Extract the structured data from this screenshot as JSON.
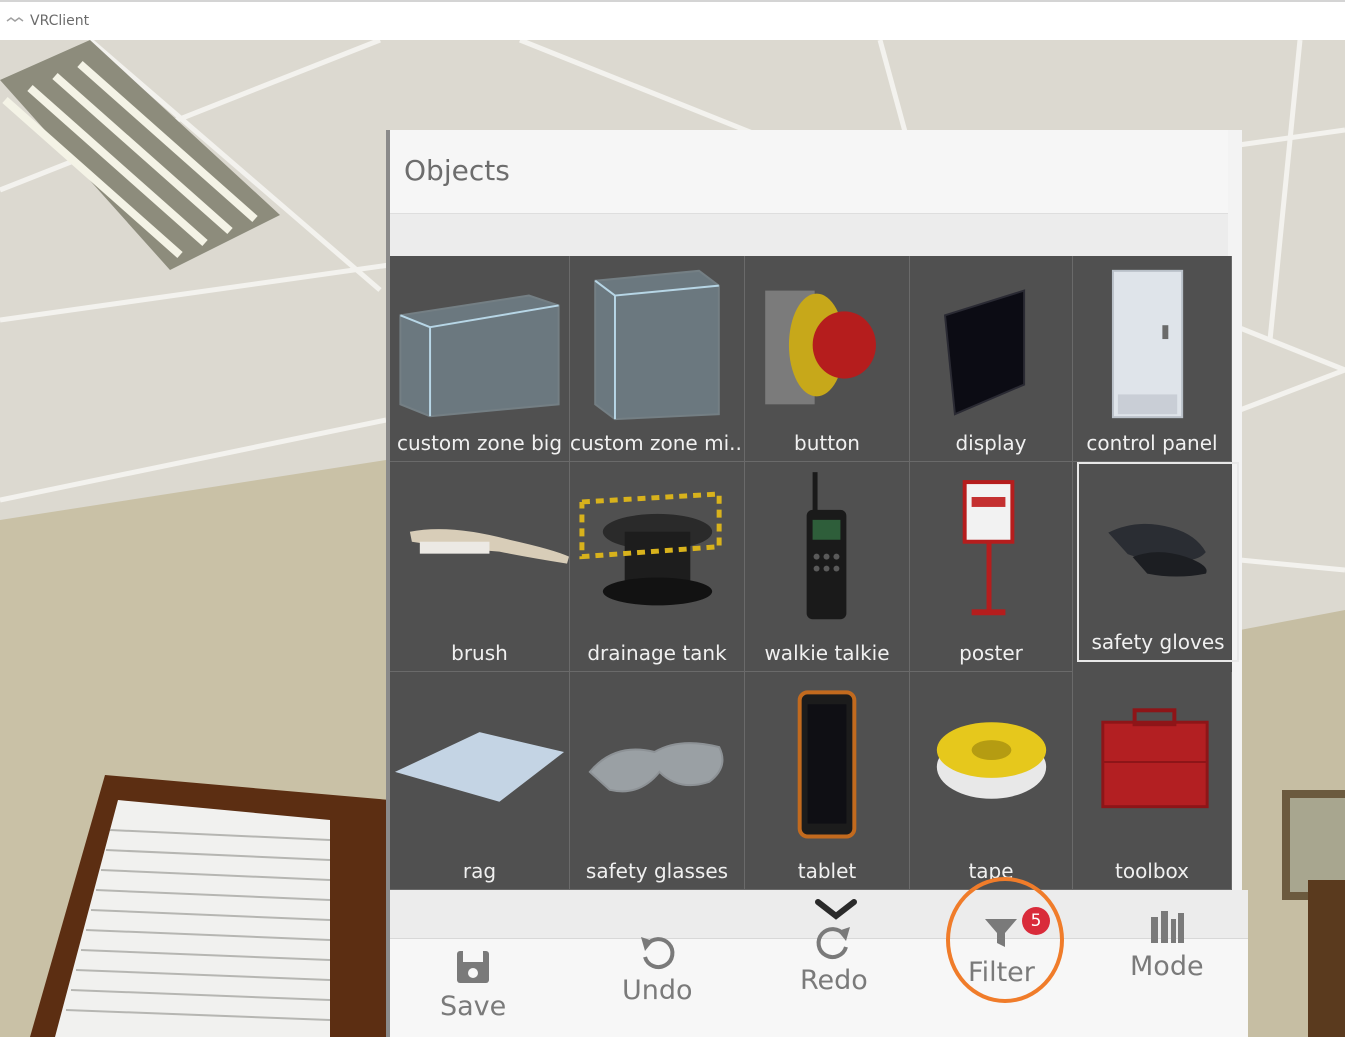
{
  "window": {
    "title": "VRClient"
  },
  "panel": {
    "title": "Objects",
    "items": [
      {
        "label": "custom zone big",
        "icon": "glass-box-icon"
      },
      {
        "label": "custom zone mi...",
        "icon": "glass-cube-icon"
      },
      {
        "label": "button",
        "icon": "emergency-button-icon"
      },
      {
        "label": "display",
        "icon": "monitor-icon"
      },
      {
        "label": "control panel",
        "icon": "cabinet-icon"
      },
      {
        "label": "brush",
        "icon": "brush-icon"
      },
      {
        "label": "drainage tank",
        "icon": "tank-icon"
      },
      {
        "label": "walkie talkie",
        "icon": "radio-icon"
      },
      {
        "label": "poster",
        "icon": "poster-stand-icon"
      },
      {
        "label": "safety gloves",
        "icon": "gloves-icon",
        "selected": true
      },
      {
        "label": "rag",
        "icon": "rag-icon"
      },
      {
        "label": "safety glasses",
        "icon": "glasses-icon"
      },
      {
        "label": "tablet",
        "icon": "tablet-icon"
      },
      {
        "label": "tape",
        "icon": "tape-roll-icon"
      },
      {
        "label": "toolbox",
        "icon": "toolbox-icon"
      }
    ]
  },
  "toolbar": {
    "save_label": "Save",
    "undo_label": "Undo",
    "redo_label": "Redo",
    "filter_label": "Filter",
    "filter_badge": "5",
    "mode_label": "Mode"
  },
  "colors": {
    "badge": "#d92b3a",
    "highlight": "#f07c2a",
    "grid_bg": "#505050"
  }
}
